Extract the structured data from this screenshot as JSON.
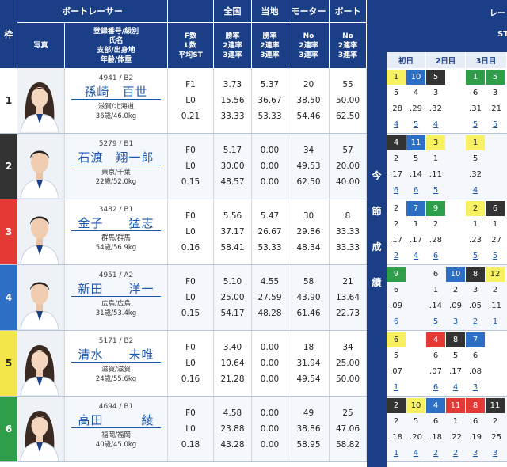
{
  "header": {
    "waku": "枠",
    "boatracer": "ボートレーサー",
    "national": "全国",
    "local": "当地",
    "motor": "モーター",
    "boat": "ボート",
    "sub_photo": "写真",
    "sub_info": [
      "登録番号/級別",
      "氏名",
      "支部/出身地",
      "年齢/体重"
    ],
    "sub_fl": [
      "F数",
      "L数",
      "平均ST"
    ],
    "sub_rates": [
      "勝率",
      "2連率",
      "3連率"
    ],
    "sub_motor": [
      "No",
      "2連率",
      "3連率"
    ],
    "sub_boat": [
      "No",
      "2連率",
      "3連率"
    ]
  },
  "right_panel": {
    "header_fragments": [
      "レー",
      "ST"
    ],
    "side_label": [
      "今",
      "節",
      "成",
      "績"
    ],
    "days": [
      "初日",
      "2日目",
      "3日目"
    ]
  },
  "racers": [
    {
      "waku": "1",
      "waku_bg": "#ffffff",
      "waku_fg": "#222222",
      "reg": "4941 / B2",
      "name": "孫崎　百世",
      "branch": "滋賀/北海道",
      "age_weight": "36歳/46.0kg",
      "fl": [
        "F1",
        "L0",
        "0.21"
      ],
      "national": [
        "3.73",
        "15.56",
        "33.33"
      ],
      "local": [
        "5.37",
        "36.67",
        "53.33"
      ],
      "motor": [
        "20",
        "38.50",
        "54.46"
      ],
      "boat": [
        "55",
        "50.00",
        "62.50"
      ],
      "gender": "f"
    },
    {
      "waku": "2",
      "waku_bg": "#333333",
      "waku_fg": "#ffffff",
      "reg": "5279 / B1",
      "name": "石渡　翔一郎",
      "branch": "東京/千葉",
      "age_weight": "22歳/52.0kg",
      "fl": [
        "F0",
        "L0",
        "0.15"
      ],
      "national": [
        "5.17",
        "30.00",
        "48.57"
      ],
      "local": [
        "0.00",
        "0.00",
        "0.00"
      ],
      "motor": [
        "34",
        "49.53",
        "62.50"
      ],
      "boat": [
        "57",
        "20.00",
        "40.00"
      ],
      "gender": "m"
    },
    {
      "waku": "3",
      "waku_bg": "#e33a36",
      "waku_fg": "#ffffff",
      "reg": "3482 / B1",
      "name": "金子　　猛志",
      "branch": "群馬/群馬",
      "age_weight": "54歳/56.9kg",
      "fl": [
        "F0",
        "L0",
        "0.16"
      ],
      "national": [
        "5.56",
        "37.17",
        "58.41"
      ],
      "local": [
        "5.47",
        "26.67",
        "53.33"
      ],
      "motor": [
        "30",
        "29.86",
        "48.34"
      ],
      "boat": [
        "8",
        "33.33",
        "33.33"
      ],
      "gender": "m"
    },
    {
      "waku": "4",
      "waku_bg": "#2d6fc4",
      "waku_fg": "#ffffff",
      "reg": "4951 / A2",
      "name": "新田　　洋一",
      "branch": "広島/広島",
      "age_weight": "31歳/53.4kg",
      "fl": [
        "F0",
        "L0",
        "0.15"
      ],
      "national": [
        "5.10",
        "25.00",
        "54.17"
      ],
      "local": [
        "4.55",
        "27.59",
        "48.28"
      ],
      "motor": [
        "58",
        "43.90",
        "61.46"
      ],
      "boat": [
        "21",
        "13.64",
        "22.73"
      ],
      "gender": "m"
    },
    {
      "waku": "5",
      "waku_bg": "#f2e64a",
      "waku_fg": "#222222",
      "reg": "5171 / B2",
      "name": "清水　　未唯",
      "branch": "滋賀/滋賀",
      "age_weight": "24歳/55.6kg",
      "fl": [
        "F0",
        "L0",
        "0.16"
      ],
      "national": [
        "3.40",
        "10.64",
        "21.28"
      ],
      "local": [
        "0.00",
        "0.00",
        "0.00"
      ],
      "motor": [
        "18",
        "31.94",
        "49.54"
      ],
      "boat": [
        "34",
        "25.00",
        "50.00"
      ],
      "gender": "f"
    },
    {
      "waku": "6",
      "waku_bg": "#2f9e4a",
      "waku_fg": "#ffffff",
      "reg": "4694 / B1",
      "name": "高田　　　綾",
      "branch": "福岡/福岡",
      "age_weight": "40歳/45.0kg",
      "fl": [
        "F0",
        "L0",
        "0.18"
      ],
      "national": [
        "4.58",
        "23.88",
        "43.28"
      ],
      "local": [
        "0.00",
        "0.00",
        "0.00"
      ],
      "motor": [
        "49",
        "38.86",
        "58.95"
      ],
      "boat": [
        "25",
        "47.06",
        "58.82"
      ],
      "gender": "f"
    }
  ],
  "results": [
    {
      "rows": [
        [
          {
            "t": "1",
            "bg": "#f7f060"
          },
          {
            "t": "10",
            "bg": "#2d6fc4",
            "fg": "#fff"
          },
          {
            "t": "5",
            "bg": "#333",
            "fg": "#fff"
          },
          {
            "t": ""
          },
          {
            "t": "1",
            "bg": "#2f9e4a",
            "fg": "#fff"
          },
          {
            "t": "5",
            "bg": "#2f9e4a",
            "fg": "#fff"
          }
        ],
        [
          {
            "t": "5"
          },
          {
            "t": "4"
          },
          {
            "t": "3"
          },
          {
            "t": ""
          },
          {
            "t": "6"
          },
          {
            "t": "3"
          }
        ],
        [
          {
            "t": ".28"
          },
          {
            "t": ".29"
          },
          {
            "t": ".32"
          },
          {
            "t": ""
          },
          {
            "t": ".31"
          },
          {
            "t": ".21"
          }
        ],
        [
          {
            "t": "4",
            "l": 1
          },
          {
            "t": "5",
            "l": 1
          },
          {
            "t": "4",
            "l": 1
          },
          {
            "t": ""
          },
          {
            "t": "5",
            "l": 1
          },
          {
            "t": "5",
            "l": 1
          }
        ]
      ]
    },
    {
      "rows": [
        [
          {
            "t": "4",
            "bg": "#333",
            "fg": "#fff"
          },
          {
            "t": "11",
            "bg": "#2d6fc4",
            "fg": "#fff"
          },
          {
            "t": "3",
            "bg": "#f7f060"
          },
          {
            "t": ""
          },
          {
            "t": "1",
            "bg": "#f7f060"
          },
          {
            "t": ""
          }
        ],
        [
          {
            "t": "2"
          },
          {
            "t": "5"
          },
          {
            "t": "1"
          },
          {
            "t": ""
          },
          {
            "t": "5"
          },
          {
            "t": ""
          }
        ],
        [
          {
            "t": ".17"
          },
          {
            "t": ".14"
          },
          {
            "t": ".11"
          },
          {
            "t": ""
          },
          {
            "t": ".32"
          },
          {
            "t": ""
          }
        ],
        [
          {
            "t": "6",
            "l": 1
          },
          {
            "t": "6",
            "l": 1
          },
          {
            "t": "5",
            "l": 1
          },
          {
            "t": ""
          },
          {
            "t": "4",
            "l": 1
          },
          {
            "t": ""
          }
        ]
      ]
    },
    {
      "rows": [
        [
          {
            "t": "2"
          },
          {
            "t": "7",
            "bg": "#2d6fc4",
            "fg": "#fff"
          },
          {
            "t": "9",
            "bg": "#2f9e4a",
            "fg": "#fff"
          },
          {
            "t": ""
          },
          {
            "t": "2",
            "bg": "#f7f060"
          },
          {
            "t": "6",
            "bg": "#333",
            "fg": "#fff"
          }
        ],
        [
          {
            "t": "2"
          },
          {
            "t": "1"
          },
          {
            "t": "2"
          },
          {
            "t": ""
          },
          {
            "t": "1"
          },
          {
            "t": "1"
          }
        ],
        [
          {
            "t": ".17"
          },
          {
            "t": ".17"
          },
          {
            "t": ".28"
          },
          {
            "t": ""
          },
          {
            "t": ".23"
          },
          {
            "t": ".27"
          }
        ],
        [
          {
            "t": "2",
            "l": 1
          },
          {
            "t": "4",
            "l": 1
          },
          {
            "t": "6",
            "l": 1
          },
          {
            "t": ""
          },
          {
            "t": "5",
            "l": 1
          },
          {
            "t": "5",
            "l": 1
          }
        ]
      ]
    },
    {
      "rows": [
        [
          {
            "t": "9",
            "bg": "#2f9e4a",
            "fg": "#fff"
          },
          {
            "t": ""
          },
          {
            "t": "6"
          },
          {
            "t": "10",
            "bg": "#2d6fc4",
            "fg": "#fff"
          },
          {
            "t": "8",
            "bg": "#333",
            "fg": "#fff"
          },
          {
            "t": "12",
            "bg": "#f7f060"
          }
        ],
        [
          {
            "t": "6"
          },
          {
            "t": ""
          },
          {
            "t": "1"
          },
          {
            "t": "2"
          },
          {
            "t": "3"
          },
          {
            "t": "2"
          }
        ],
        [
          {
            "t": ".09"
          },
          {
            "t": ""
          },
          {
            "t": ".14"
          },
          {
            "t": ".09"
          },
          {
            "t": ".05"
          },
          {
            "t": ".11"
          }
        ],
        [
          {
            "t": "6",
            "l": 1
          },
          {
            "t": ""
          },
          {
            "t": "5",
            "l": 1
          },
          {
            "t": "3",
            "l": 1
          },
          {
            "t": "2",
            "l": 1
          },
          {
            "t": "1",
            "l": 1
          }
        ]
      ]
    },
    {
      "rows": [
        [
          {
            "t": "6",
            "bg": "#f7f060"
          },
          {
            "t": ""
          },
          {
            "t": "4",
            "bg": "#e33a36",
            "fg": "#fff"
          },
          {
            "t": "8",
            "bg": "#333",
            "fg": "#fff"
          },
          {
            "t": "7",
            "bg": "#2d6fc4",
            "fg": "#fff"
          },
          {
            "t": ""
          }
        ],
        [
          {
            "t": "5"
          },
          {
            "t": ""
          },
          {
            "t": "6"
          },
          {
            "t": "5"
          },
          {
            "t": "6"
          },
          {
            "t": ""
          }
        ],
        [
          {
            "t": ".07"
          },
          {
            "t": ""
          },
          {
            "t": ".07"
          },
          {
            "t": ".17"
          },
          {
            "t": ".08"
          },
          {
            "t": ""
          }
        ],
        [
          {
            "t": "1",
            "l": 1
          },
          {
            "t": ""
          },
          {
            "t": "6",
            "l": 1
          },
          {
            "t": "4",
            "l": 1
          },
          {
            "t": "3",
            "l": 1
          },
          {
            "t": ""
          }
        ]
      ]
    },
    {
      "rows": [
        [
          {
            "t": "2",
            "bg": "#333",
            "fg": "#fff"
          },
          {
            "t": "10",
            "bg": "#f7f060"
          },
          {
            "t": "4",
            "bg": "#2d6fc4",
            "fg": "#fff"
          },
          {
            "t": "11",
            "bg": "#e33a36",
            "fg": "#fff"
          },
          {
            "t": "8",
            "bg": "#e33a36",
            "fg": "#fff"
          },
          {
            "t": "11",
            "bg": "#333",
            "fg": "#fff"
          }
        ],
        [
          {
            "t": "2"
          },
          {
            "t": "5"
          },
          {
            "t": "6"
          },
          {
            "t": "1"
          },
          {
            "t": "6"
          },
          {
            "t": "2"
          }
        ],
        [
          {
            "t": ".18"
          },
          {
            "t": ".20"
          },
          {
            "t": ".18"
          },
          {
            "t": ".22"
          },
          {
            "t": ".19"
          },
          {
            "t": ".25"
          }
        ],
        [
          {
            "t": "1",
            "l": 1
          },
          {
            "t": "4",
            "l": 1
          },
          {
            "t": "2",
            "l": 1
          },
          {
            "t": "2",
            "l": 1
          },
          {
            "t": "3",
            "l": 1
          },
          {
            "t": "3",
            "l": 1
          }
        ]
      ]
    }
  ]
}
